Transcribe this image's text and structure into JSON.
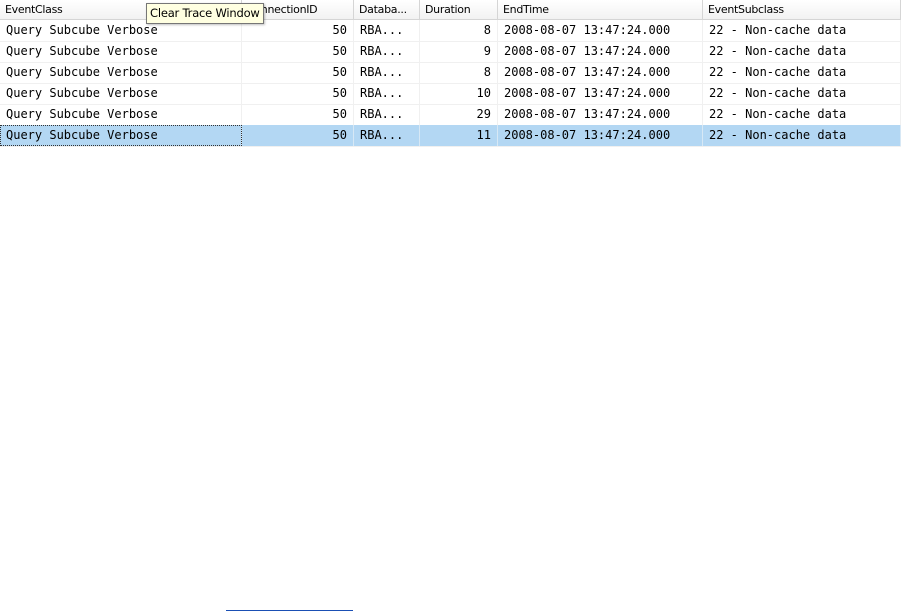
{
  "columns": [
    "EventClass",
    "ConnectionID",
    "Databa...",
    "Duration",
    "EndTime",
    "EventSubclass"
  ],
  "rows": [
    {
      "event_class": "Query Subcube Verbose",
      "connection_id": "50",
      "database": "RBA...",
      "duration": "8",
      "end_time": "2008-08-07 13:47:24.000",
      "event_subclass": "22 - Non-cache data"
    },
    {
      "event_class": "Query Subcube Verbose",
      "connection_id": "50",
      "database": "RBA...",
      "duration": "9",
      "end_time": "2008-08-07 13:47:24.000",
      "event_subclass": "22 - Non-cache data"
    },
    {
      "event_class": "Query Subcube Verbose",
      "connection_id": "50",
      "database": "RBA...",
      "duration": "8",
      "end_time": "2008-08-07 13:47:24.000",
      "event_subclass": "22 - Non-cache data"
    },
    {
      "event_class": "Query Subcube Verbose",
      "connection_id": "50",
      "database": "RBA...",
      "duration": "10",
      "end_time": "2008-08-07 13:47:24.000",
      "event_subclass": "22 - Non-cache data"
    },
    {
      "event_class": "Query Subcube Verbose",
      "connection_id": "50",
      "database": "RBA...",
      "duration": "29",
      "end_time": "2008-08-07 13:47:24.000",
      "event_subclass": "22 - Non-cache data"
    },
    {
      "event_class": "Query Subcube Verbose",
      "connection_id": "50",
      "database": "RBA...",
      "duration": "11",
      "end_time": "2008-08-07 13:47:24.000",
      "event_subclass": "22 - Non-cache data"
    }
  ],
  "selected_row": 5,
  "tooltip": "Clear Trace Window",
  "colors": {
    "selection": "#b3d7f3",
    "tooltip_bg": "#ffffe1",
    "link": "#1a4fb4"
  }
}
